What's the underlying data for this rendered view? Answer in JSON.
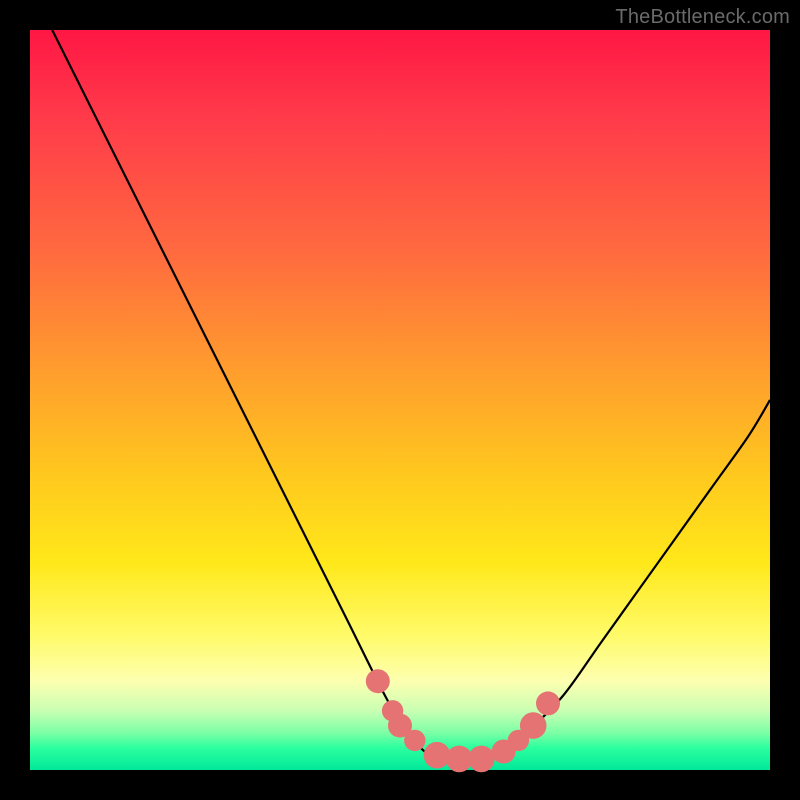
{
  "watermark": "TheBottleneck.com",
  "colors": {
    "frame": "#000000",
    "gradient_top": "#ff1744",
    "gradient_mid": "#ffe81a",
    "gradient_bottom": "#00e89a",
    "curve_stroke": "#000000",
    "marker_fill": "#e57373",
    "marker_stroke": "#c94f4f"
  },
  "chart_data": {
    "type": "line",
    "title": "",
    "xlabel": "",
    "ylabel": "",
    "xlim": [
      0,
      100
    ],
    "ylim": [
      0,
      100
    ],
    "grid": false,
    "legend": null,
    "series": [
      {
        "name": "curve",
        "x": [
          3,
          8,
          13,
          18,
          23,
          28,
          33,
          38,
          43,
          48,
          51,
          54,
          57,
          60,
          63,
          67,
          72,
          77,
          82,
          87,
          92,
          97,
          100
        ],
        "y": [
          100,
          90,
          80,
          70,
          60,
          50,
          40,
          30,
          20,
          10,
          5,
          2,
          1,
          1,
          2,
          5,
          10,
          17,
          24,
          31,
          38,
          45,
          50
        ]
      }
    ],
    "markers": [
      {
        "x": 47,
        "y": 12,
        "r": 1.2
      },
      {
        "x": 49,
        "y": 8,
        "r": 1.0
      },
      {
        "x": 50,
        "y": 6,
        "r": 1.2
      },
      {
        "x": 52,
        "y": 4,
        "r": 1.0
      },
      {
        "x": 55,
        "y": 2,
        "r": 1.4
      },
      {
        "x": 58,
        "y": 1.5,
        "r": 1.4
      },
      {
        "x": 61,
        "y": 1.5,
        "r": 1.4
      },
      {
        "x": 64,
        "y": 2.5,
        "r": 1.2
      },
      {
        "x": 66,
        "y": 4,
        "r": 1.0
      },
      {
        "x": 68,
        "y": 6,
        "r": 1.4
      },
      {
        "x": 70,
        "y": 9,
        "r": 1.2
      }
    ]
  }
}
